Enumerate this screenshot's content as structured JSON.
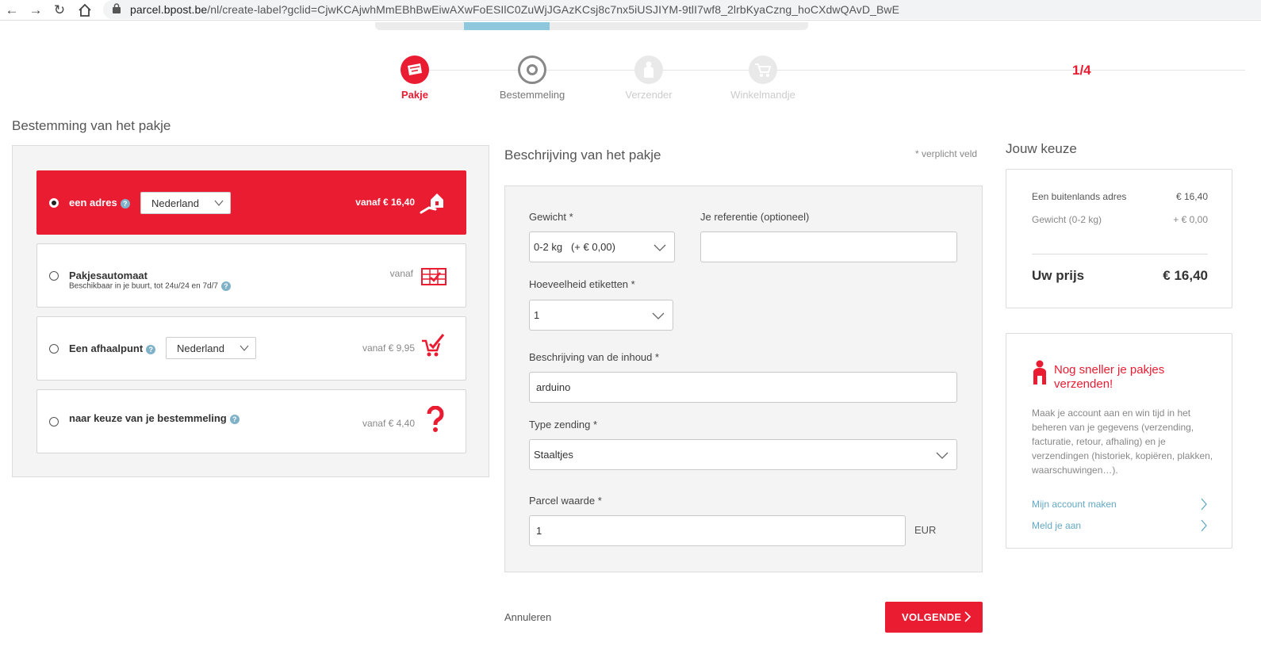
{
  "browser": {
    "url_domain": "parcel.bpost.be",
    "url_path": "/nl/create-label?gclid=CjwKCAjwhMmEBhBwEiwAXwFoESIlC0ZuWjJGAzKCsj8c7nx5iUSJIYM-9tlI7wf8_2lrbKyaCzng_hoCXdwQAvD_BwE"
  },
  "stepper": {
    "steps": [
      {
        "label": "Pakje",
        "state": "active"
      },
      {
        "label": "Bestemmeling",
        "state": "current"
      },
      {
        "label": "Verzender",
        "state": "todo"
      },
      {
        "label": "Winkelmandje",
        "state": "todo"
      }
    ],
    "count": "1/4"
  },
  "destination": {
    "title": "Bestemming van het pakje",
    "options": [
      {
        "label": "een adres",
        "select": "Nederland",
        "price": "vanaf € 16,40",
        "selected": true
      },
      {
        "label": "Pakjesautomaat",
        "sub": "Beschikbaar in je buurt, tot 24u/24 en 7d/7",
        "price": "vanaf"
      },
      {
        "label": "Een afhaalpunt",
        "select": "Nederland",
        "price": "vanaf € 9,95"
      },
      {
        "label": "naar keuze van je bestemmeling",
        "price": "vanaf € 4,40"
      }
    ]
  },
  "form": {
    "title": "Beschrijving van het pakje",
    "required_note": "* verplicht veld",
    "weight_label": "Gewicht *",
    "weight_value": "0-2 kg   (+ € 0,00)",
    "reference_label": "Je referentie (optioneel)",
    "reference_value": "",
    "quantity_label": "Hoeveelheid etiketten *",
    "quantity_value": "1",
    "contents_label": "Beschrijving van de inhoud *",
    "contents_value": "arduino",
    "type_label": "Type zending *",
    "type_value": "Staaltjes",
    "value_label": "Parcel waarde *",
    "value_value": "1",
    "currency": "EUR",
    "cancel": "Annuleren",
    "next": "VOLGENDE"
  },
  "summary": {
    "title": "Jouw keuze",
    "line1_label": "Een buitenlands adres",
    "line1_value": "€ 16,40",
    "line2_label": "Gewicht (0-2 kg)",
    "line2_value": "+ € 0,00",
    "total_label": "Uw prijs",
    "total_value": "€ 16,40"
  },
  "promo": {
    "title": "Nog sneller je pakjes verzenden!",
    "text": "Maak je account aan en win tijd in het beheren van je gegevens (verzending, facturatie, retour, afhaling) en je verzendingen (historiek, kopiëren, plakken, waarschuwingen…).",
    "link1": "Mijn account maken",
    "link2": "Meld je aan"
  },
  "colors": {
    "brand_red": "#ea1c32",
    "link_blue": "#63a8c4"
  }
}
